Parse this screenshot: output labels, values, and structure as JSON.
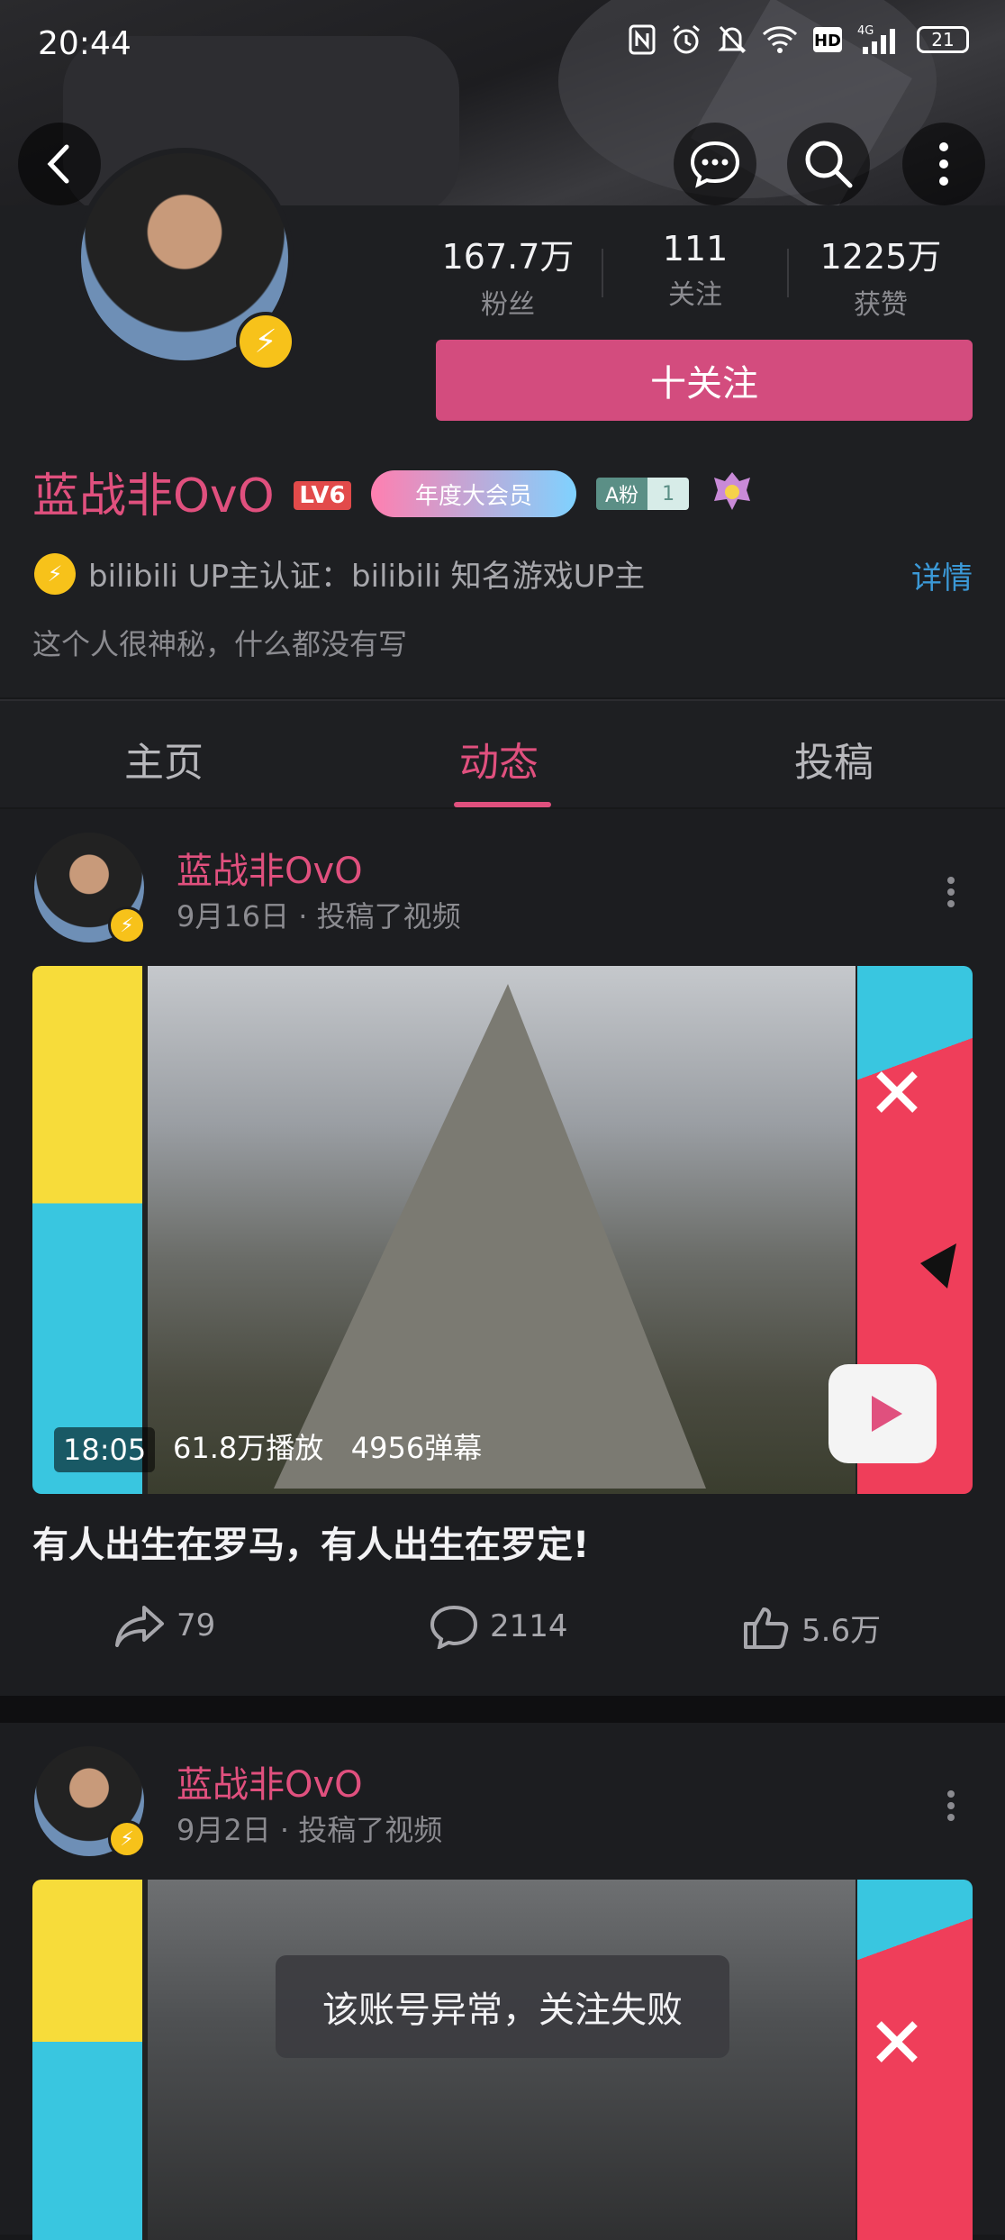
{
  "status_bar": {
    "time": "20:44",
    "icons": [
      "nfc-icon",
      "alarm-icon",
      "mute-icon",
      "wifi-icon",
      "hd-icon",
      "4g-signal-icon"
    ],
    "battery": "21"
  },
  "header": {
    "back_icon": "back-arrow-icon",
    "message_icon": "message-bubble-icon",
    "search_icon": "search-icon",
    "more_icon": "more-vertical-icon"
  },
  "profile": {
    "stats": [
      {
        "value": "167.7万",
        "label": "粉丝"
      },
      {
        "value": "111",
        "label": "关注"
      },
      {
        "value": "1225万",
        "label": "获赞"
      }
    ],
    "follow_label": "十关注",
    "username": "蓝战非OvO",
    "level_badge": "LV6",
    "vip_badge": "年度大会员",
    "fan_badge": {
      "label": "A粉",
      "level": "1"
    },
    "cert_text": "bilibili UP主认证：bilibili 知名游戏UP主",
    "detail_link": "详情",
    "bio": "这个人很神秘，什么都没有写"
  },
  "tabs": [
    {
      "label": "主页",
      "active": false
    },
    {
      "label": "动态",
      "active": true
    },
    {
      "label": "投稿",
      "active": false
    }
  ],
  "posts": [
    {
      "author": "蓝战非OvO",
      "date": "9月16日",
      "action": "投稿了视频",
      "duration": "18:05",
      "plays": "61.8万播放",
      "danmaku": "4956弹幕",
      "title": "有人出生在罗马，有人出生在罗定!",
      "shares": "79",
      "comments": "2114",
      "likes": "5.6万"
    },
    {
      "author": "蓝战非OvO",
      "date": "9月2日",
      "action": "投稿了视频"
    }
  ],
  "toast": "该账号异常，关注失败",
  "colors": {
    "accent": "#e0507e",
    "follow_button": "#d34c7e",
    "link": "#3b98d6",
    "background": "#17181a"
  }
}
